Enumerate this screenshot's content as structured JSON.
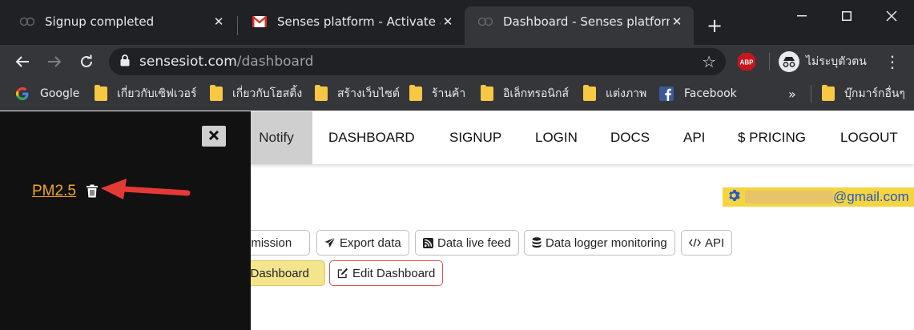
{
  "browser": {
    "tabs": [
      {
        "title": "Signup completed",
        "active": false,
        "favicon": "loading-circle-icon"
      },
      {
        "title": "Senses platform - Activate acco",
        "active": false,
        "favicon": "gmail-icon"
      },
      {
        "title": "Dashboard - Senses platform |",
        "active": true,
        "favicon": "loading-circle-icon"
      }
    ],
    "address": {
      "domain": "sensesiot.com",
      "path": "/dashboard"
    },
    "profile_label": "ไม่ระบุตัวตน",
    "abp_label": "ABP",
    "bookmarks": [
      {
        "label": "Google",
        "icon": "google-icon"
      },
      {
        "label": "เกี่ยวกับเซิฟเวอร์",
        "icon": "folder-icon"
      },
      {
        "label": "เกี่ยวกับโฮสติ้ง",
        "icon": "folder-icon"
      },
      {
        "label": "สร้างเว็บไซต์",
        "icon": "folder-icon"
      },
      {
        "label": "ร้านค้า",
        "icon": "folder-icon"
      },
      {
        "label": "อิเล็กทรอนิกส์",
        "icon": "folder-icon"
      },
      {
        "label": "แต่งภาพ",
        "icon": "folder-icon"
      },
      {
        "label": "Facebook",
        "icon": "facebook-icon"
      }
    ],
    "more_bookmarks_label": "»",
    "other_bookmarks": "บุ๊กมาร์กอื่นๆ"
  },
  "site": {
    "brand_partial": "Notify",
    "nav": [
      "DASHBOARD",
      "SIGNUP",
      "LOGIN",
      "DOCS",
      "API",
      "$ PRICING",
      "LOGOUT"
    ],
    "user_email_suffix": "@gmail.com",
    "actions_row1": [
      {
        "label": "ermission",
        "icon": "none"
      },
      {
        "label": "Export data",
        "icon": "paper-plane-icon"
      },
      {
        "label": "Data live feed",
        "icon": "rss-icon"
      },
      {
        "label": "Data logger monitoring",
        "icon": "database-icon"
      },
      {
        "label": "API",
        "icon": "code-icon"
      }
    ],
    "actions_row2": [
      {
        "label": "e Dashboard",
        "style": "yellow"
      },
      {
        "label": "Edit Dashboard",
        "style": "red-outline",
        "icon": "edit-icon"
      }
    ]
  },
  "sidepanel": {
    "dashboard_item": "PM2.5",
    "close_label": "✖"
  },
  "colors": {
    "chrome_dark": "#202124",
    "chrome_toolbar": "#35363a",
    "sidepanel_bg": "#111111",
    "link_orange": "#f0a52a",
    "arrow_red": "#e53935",
    "email_bg": "#f5d442",
    "email_text": "#2458c9"
  }
}
